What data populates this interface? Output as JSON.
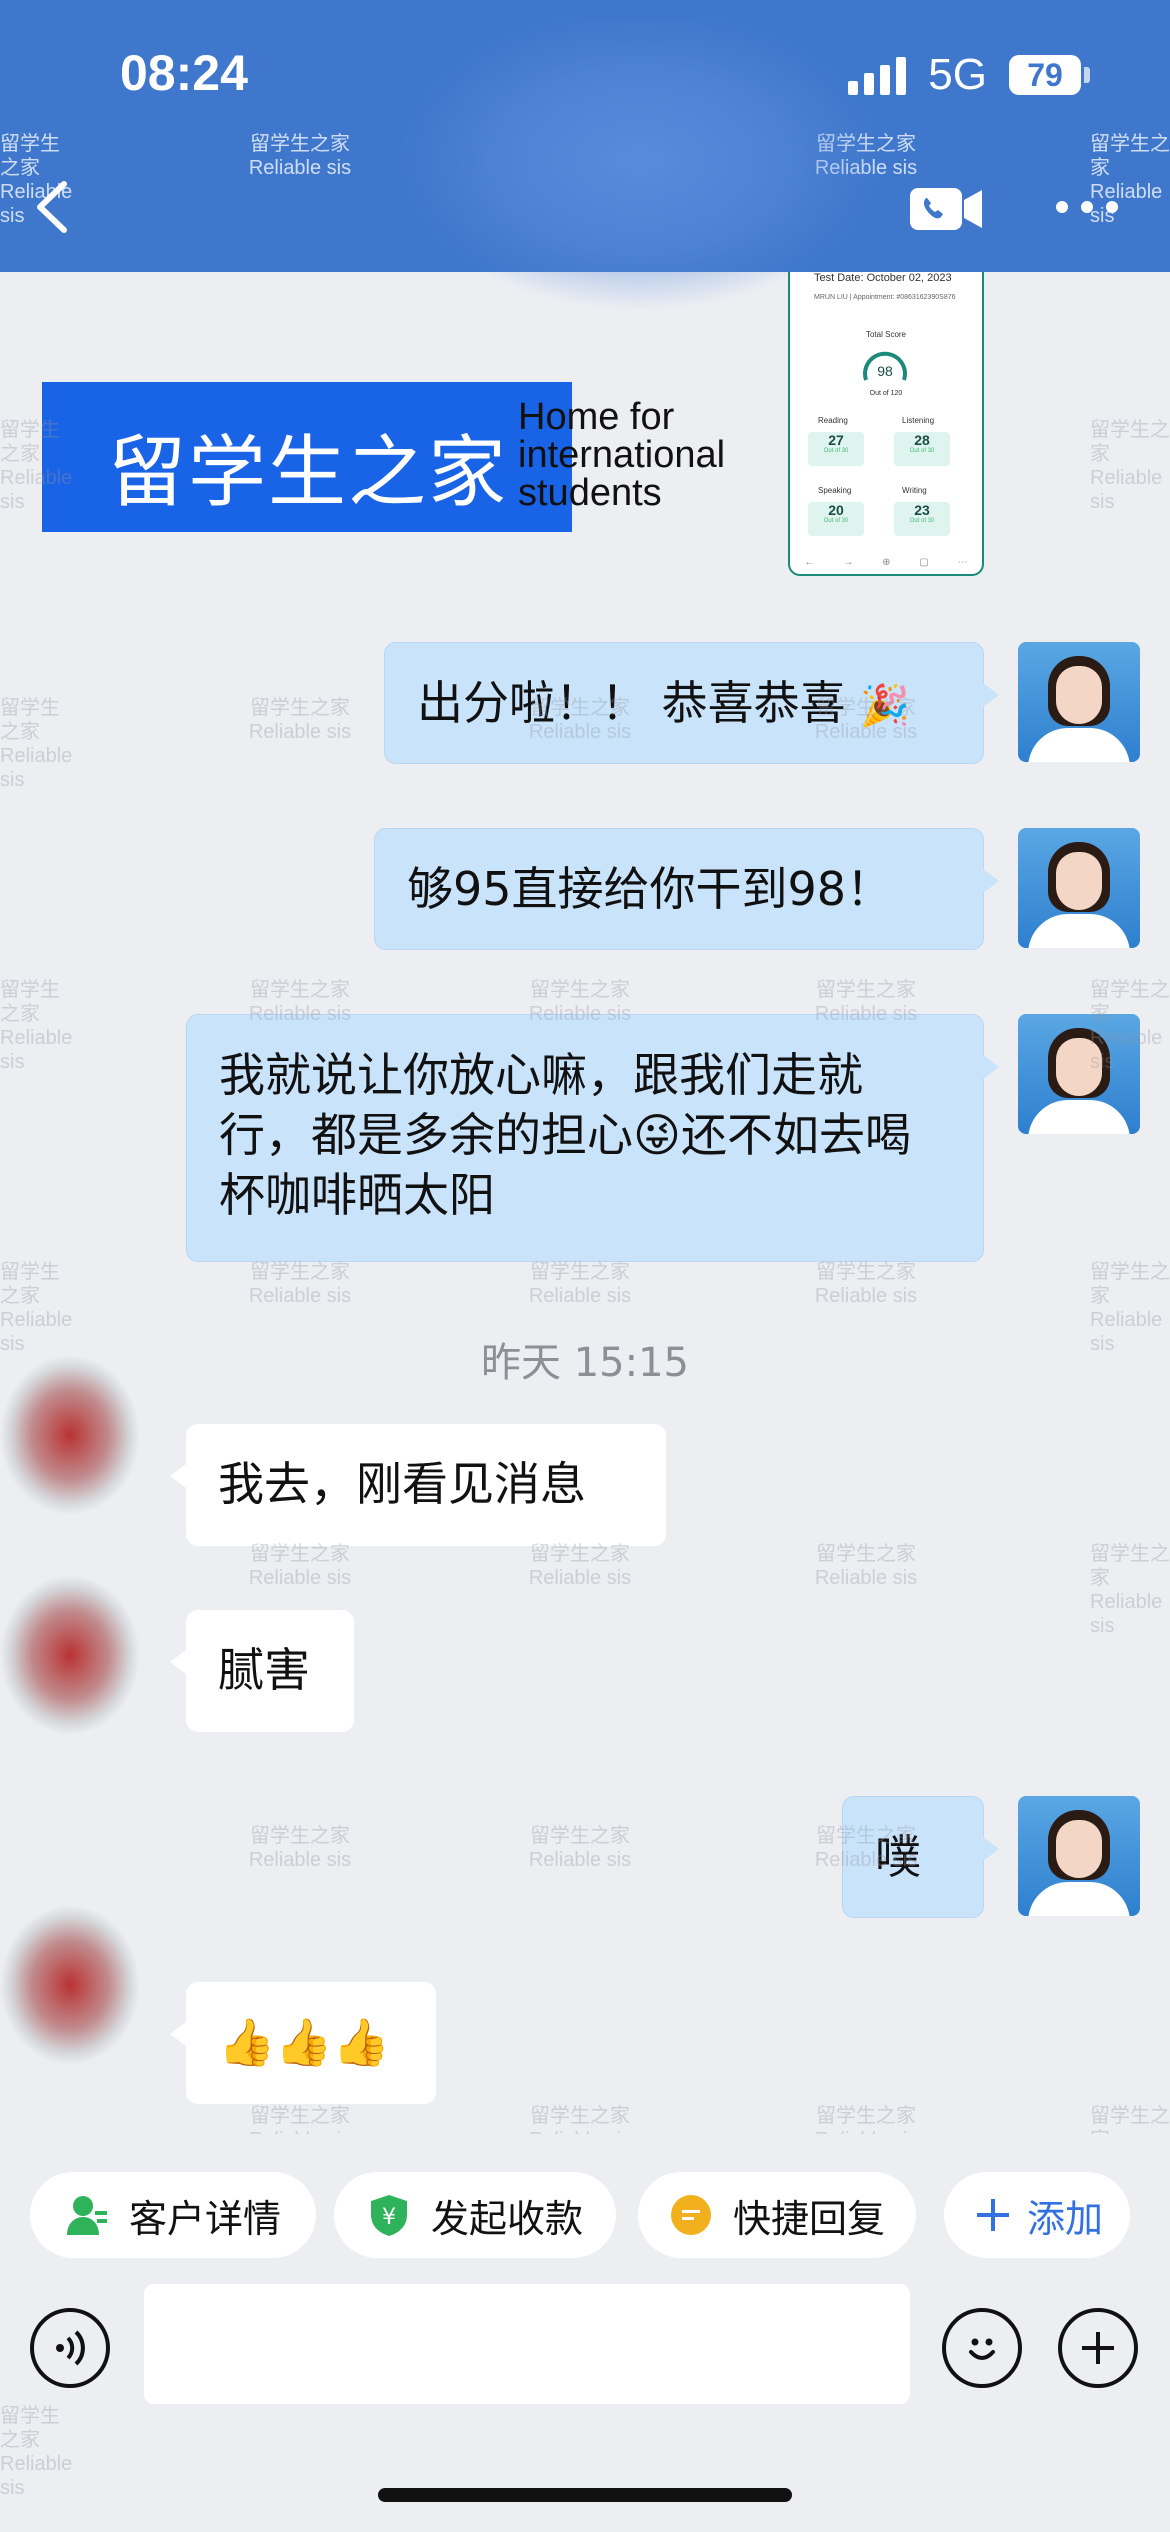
{
  "status_bar": {
    "time": "08:24",
    "network": "5G",
    "battery": "79"
  },
  "watermark": {
    "line1": "留学生之家",
    "line2": "Reliable sis"
  },
  "promo": {
    "banner_cn": "留学生之家",
    "banner_en_lines": [
      "Home for",
      "international",
      "students"
    ],
    "score_card": {
      "test_date": "Test Date: October 02, 2023",
      "candidate_line": "MRUN LIU | Appointment: #0863162390S876",
      "total_label": "Total Score",
      "total": "98",
      "total_out_of": "Out of 120",
      "sections": [
        {
          "name": "Reading",
          "score": "27",
          "out_of": "Out of 30"
        },
        {
          "name": "Listening",
          "score": "28",
          "out_of": "Out of 30"
        },
        {
          "name": "Speaking",
          "score": "20",
          "out_of": "Out of 30"
        },
        {
          "name": "Writing",
          "score": "23",
          "out_of": "Out of 30"
        }
      ]
    }
  },
  "messages": [
    {
      "side": "out",
      "text": "出分啦！！ 恭喜恭喜"
    },
    {
      "side": "out",
      "text": "够95直接给你干到98！"
    },
    {
      "side": "out",
      "text": "我就说让你放心嘛，跟我们走就行，都是多余的担心😜还不如去喝杯咖啡晒太阳"
    },
    {
      "side": "in",
      "text": "我去，刚看见消息"
    },
    {
      "side": "in",
      "text": "腻害"
    },
    {
      "side": "out",
      "text": "噗"
    },
    {
      "side": "in",
      "text": "👍👍👍"
    }
  ],
  "timestamp": "昨天 15:15",
  "quick_actions": {
    "customer_details": "客户详情",
    "request_payment": "发起收款",
    "quick_reply": "快捷回复",
    "add": "添加"
  },
  "colors": {
    "header": "#3f77cc",
    "outgoing_bubble": "#c9e3fb",
    "accent": "#3370e0"
  }
}
